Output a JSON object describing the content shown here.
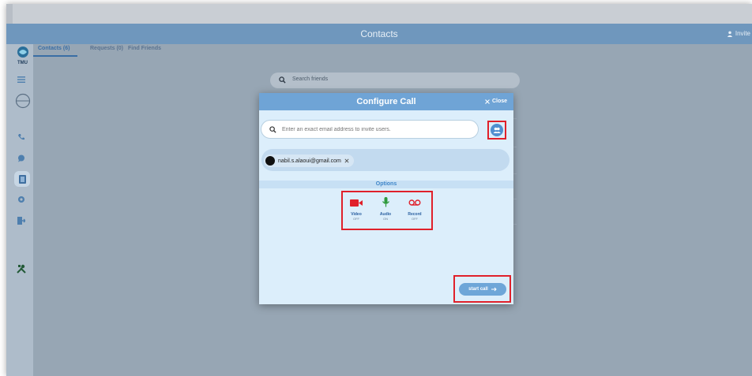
{
  "header": {
    "title": "Contacts",
    "invite_label": "Invite"
  },
  "sidebar": {
    "logo_text": "TMU",
    "items": [
      {
        "icon": "menu-icon"
      },
      {
        "icon": "globe-icon"
      },
      {
        "icon": "phone-icon"
      },
      {
        "icon": "chat-icon"
      },
      {
        "icon": "contacts-book-icon"
      },
      {
        "icon": "settings-icon"
      },
      {
        "icon": "logout-icon"
      },
      {
        "icon": "tools-icon"
      }
    ]
  },
  "tabs": [
    {
      "label": "Contacts (6)",
      "active": true
    },
    {
      "label": "Requests (0)",
      "active": false
    },
    {
      "label": "Find Friends",
      "active": false
    }
  ],
  "background_search": {
    "placeholder": "Search friends"
  },
  "dialog": {
    "title": "Configure Call",
    "close_label": "Close",
    "email_placeholder": "Enter an exact email address to invite users.",
    "selected_user": "nabil.s.alaoui@gmail.com",
    "options_heading": "Options",
    "options": [
      {
        "label": "Video",
        "state": "OFF",
        "color": "#e0202a"
      },
      {
        "label": "Audio",
        "state": "ON",
        "color": "#2e9a3c"
      },
      {
        "label": "Record",
        "state": "OFF",
        "color": "#e0202a"
      }
    ],
    "start_label": "start call",
    "accent_color": "#6fa4d6",
    "highlight_color": "#e0202a"
  }
}
